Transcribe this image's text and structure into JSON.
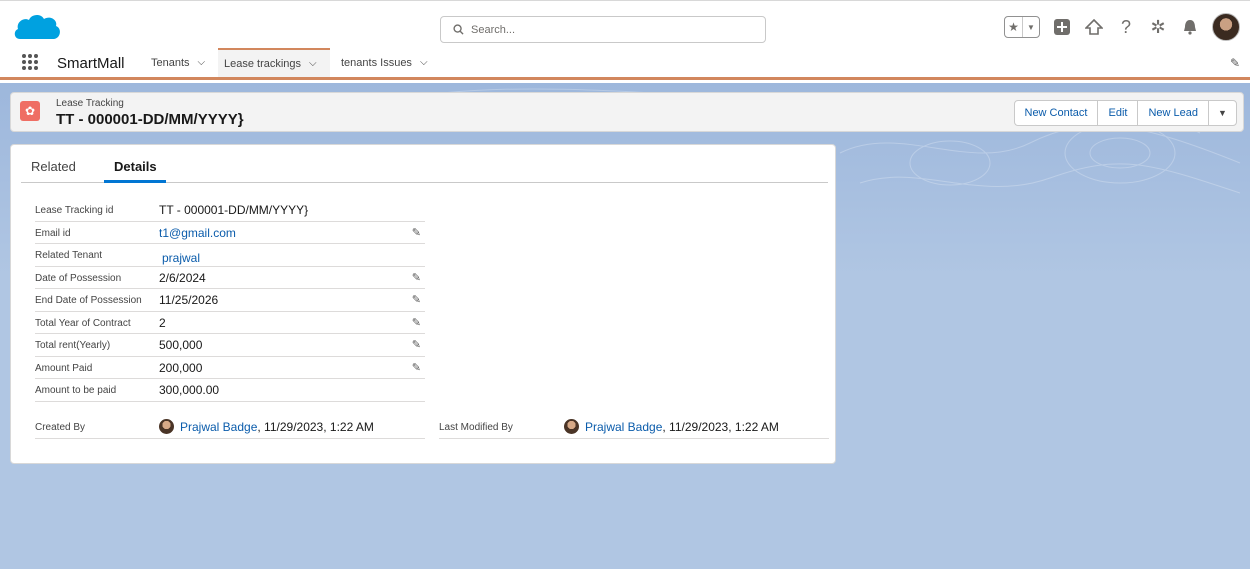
{
  "search": {
    "placeholder": "Search..."
  },
  "app": {
    "name": "SmartMall"
  },
  "nav": {
    "tabs": [
      {
        "label": "Tenants"
      },
      {
        "label": "Lease trackings"
      },
      {
        "label": "tenants Issues"
      }
    ]
  },
  "record": {
    "type": "Lease Tracking",
    "title": "TT - 000001-DD/MM/YYYY}",
    "actions": {
      "new_contact": "New Contact",
      "edit": "Edit",
      "new_lead": "New Lead"
    }
  },
  "detail_tabs": {
    "related": "Related",
    "details": "Details"
  },
  "fields": [
    {
      "label": "Lease Tracking id",
      "value": "TT - 000001-DD/MM/YYYY}"
    },
    {
      "label": "Email id",
      "value": "t1@gmail.com"
    },
    {
      "label": "Related Tenant",
      "value": "prajwal"
    },
    {
      "label": "Date of Possession",
      "value": "2/6/2024"
    },
    {
      "label": "End Date of Possession",
      "value": "11/25/2026"
    },
    {
      "label": "Total Year of Contract",
      "value": "2"
    },
    {
      "label": "Total rent(Yearly)",
      "value": "500,000"
    },
    {
      "label": "Amount Paid",
      "value": "200,000"
    },
    {
      "label": "Amount to be paid",
      "value": "300,000.00"
    }
  ],
  "created": {
    "label": "Created By",
    "user": "Prajwal Badge",
    "date": ", 11/29/2023, 1:22 AM"
  },
  "modified": {
    "label": "Last Modified By",
    "user": "Prajwal Badge",
    "date": ", 11/29/2023, 1:22 AM"
  },
  "colors": {
    "brand": "#00a1e0",
    "accent": "#d2875d",
    "link": "#0b5cab",
    "record_icon": "#ef6e64"
  },
  "icons": [
    "salesforce-cloud-icon",
    "search-icon",
    "star-icon",
    "add-icon",
    "trailhead-icon",
    "help-icon",
    "setup-gear-icon",
    "bell-icon",
    "app-launcher-icon",
    "pencil-icon"
  ]
}
